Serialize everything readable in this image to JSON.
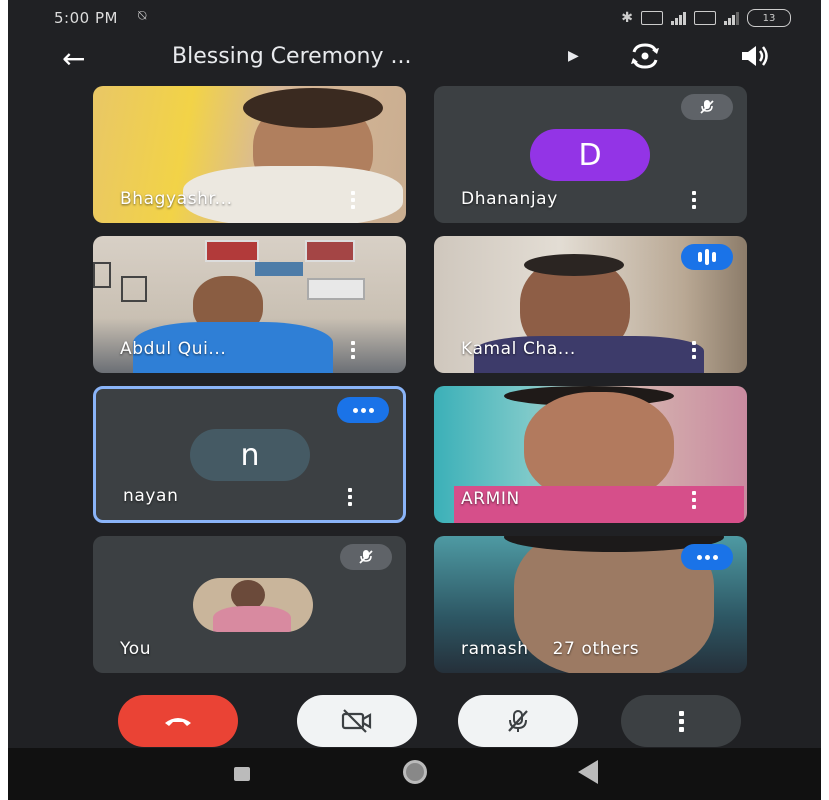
{
  "status_bar": {
    "time": "5:00 PM",
    "battery": "13"
  },
  "meeting": {
    "title": "Blessing Ceremony ..."
  },
  "participants": [
    {
      "name": "Bhagyashr...",
      "video": true
    },
    {
      "name": "Dhananjay",
      "initial": "D",
      "muted": true
    },
    {
      "name": "Abdul Qui...",
      "video": true
    },
    {
      "name": "Kamal Cha...",
      "video": true,
      "speaking": true
    },
    {
      "name": "nayan",
      "initial": "n",
      "pinned": true
    },
    {
      "name": "ARMIN",
      "video": true
    },
    {
      "name": "You",
      "muted": true,
      "self": true
    },
    {
      "name": "ramash",
      "others_label": "27 others",
      "video": true
    }
  ],
  "controls": {
    "end_call": "end-call-icon",
    "camera": "camera-off-icon",
    "mic": "mic-off-icon",
    "more": "more-vert-icon"
  },
  "colors": {
    "background": "#202124",
    "tile": "#3c4043",
    "end_call": "#ea4335",
    "accent_blue": "#1a73e8",
    "avatar_d": "#9334e6",
    "avatar_n": "#455a64"
  }
}
